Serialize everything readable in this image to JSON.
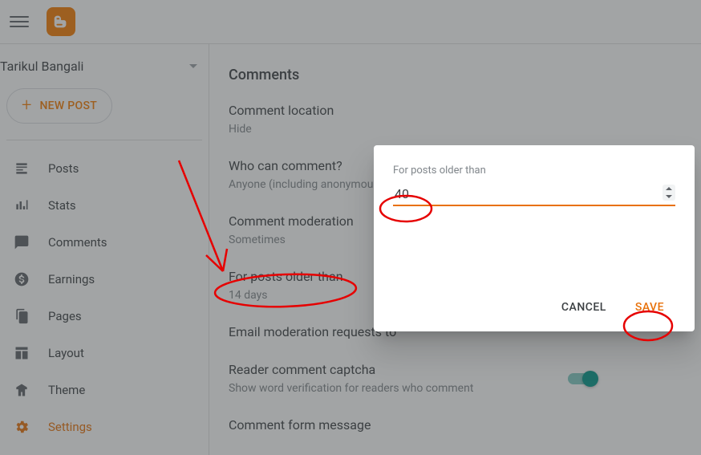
{
  "header": {
    "blog_name": "Tarikul Bangali",
    "new_post_label": "NEW POST"
  },
  "sidebar": {
    "items": [
      {
        "label": "Posts"
      },
      {
        "label": "Stats"
      },
      {
        "label": "Comments"
      },
      {
        "label": "Earnings"
      },
      {
        "label": "Pages"
      },
      {
        "label": "Layout"
      },
      {
        "label": "Theme"
      },
      {
        "label": "Settings"
      }
    ],
    "active_index": 7
  },
  "content": {
    "section_title": "Comments",
    "settings": {
      "comment_location": {
        "label": "Comment location",
        "value": "Hide"
      },
      "who_can_comment": {
        "label": "Who can comment?",
        "value": "Anyone (including anonymous)"
      },
      "comment_moderation": {
        "label": "Comment moderation",
        "value": "Sometimes"
      },
      "for_posts_older": {
        "label": "For posts older than",
        "value": "14 days"
      },
      "email_moderation": {
        "label": "Email moderation requests to"
      },
      "captcha": {
        "label": "Reader comment captcha",
        "value": "Show word verification for readers who comment",
        "on": true
      },
      "comment_form_message": {
        "label": "Comment form message"
      }
    }
  },
  "dialog": {
    "title": "For posts older than",
    "input_value": "40",
    "cancel_label": "CANCEL",
    "save_label": "SAVE"
  },
  "annotation_color": "#e60000"
}
